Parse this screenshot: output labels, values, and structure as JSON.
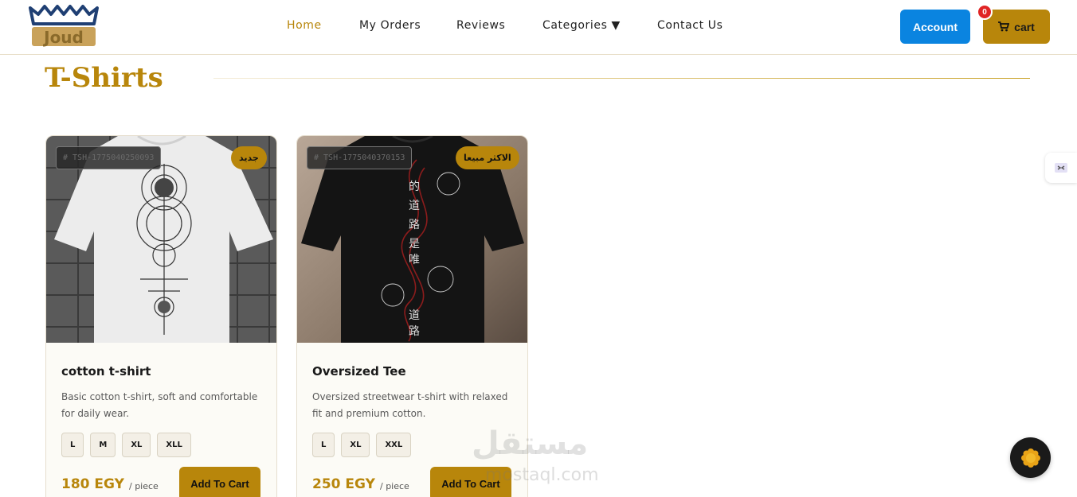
{
  "brand": {
    "logo_text": "Joud",
    "accent": "#b8860b"
  },
  "nav": {
    "items": [
      {
        "label": "Home",
        "active": true
      },
      {
        "label": "My Orders",
        "active": false
      },
      {
        "label": "Reviews",
        "active": false
      },
      {
        "label": "Categories ▼",
        "active": false
      },
      {
        "label": "Contact Us",
        "active": false
      }
    ]
  },
  "header": {
    "account_label": "Account",
    "cart_label": "cart",
    "cart_count": "0",
    "account_color": "#0a84e0"
  },
  "section": {
    "title": "T-Shirts"
  },
  "products": [
    {
      "sku": "# TSH-1775040250093",
      "badge": "جديد",
      "name": "cotton t-shirt",
      "description": "Basic cotton t-shirt, soft and comfortable for daily wear.",
      "sizes": [
        "L",
        "M",
        "XL",
        "XLL"
      ],
      "price": "180 EGY",
      "unit": "/ piece",
      "add_label": "Add To Cart",
      "shirt_color": "white"
    },
    {
      "sku": "# TSH-1775040370153",
      "badge": "الاكثر مبيعا",
      "name": "Oversized Tee",
      "description": "Oversized streetwear t-shirt with relaxed fit and premium cotton.",
      "sizes": [
        "L",
        "XL",
        "XXL"
      ],
      "price": "250 EGY",
      "unit": "/ piece",
      "add_label": "Add To Cart",
      "shirt_color": "black"
    }
  ],
  "watermark": {
    "arabic": "مستقل",
    "latin": "mostaql.com"
  }
}
